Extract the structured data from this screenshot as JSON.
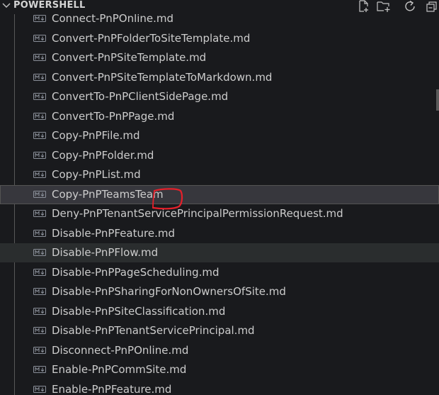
{
  "section": {
    "title": "POWERSHELL",
    "chevron_icon": "chevron-down-icon",
    "actions": [
      {
        "name": "new-file-button",
        "icon": "new-file-icon"
      },
      {
        "name": "new-folder-button",
        "icon": "new-folder-icon"
      },
      {
        "name": "refresh-button",
        "icon": "refresh-icon"
      },
      {
        "name": "collapse-folders-button",
        "icon": "collapse-all-icon"
      }
    ]
  },
  "files": [
    {
      "label": "Connect-PnPOnline.md",
      "icon": "markdown-icon"
    },
    {
      "label": "Convert-PnPFolderToSiteTemplate.md",
      "icon": "markdown-icon"
    },
    {
      "label": "Convert-PnPSiteTemplate.md",
      "icon": "markdown-icon"
    },
    {
      "label": "Convert-PnPSiteTemplateToMarkdown.md",
      "icon": "markdown-icon"
    },
    {
      "label": "ConvertTo-PnPClientSidePage.md",
      "icon": "markdown-icon"
    },
    {
      "label": "ConvertTo-PnPPage.md",
      "icon": "markdown-icon"
    },
    {
      "label": "Copy-PnPFile.md",
      "icon": "markdown-icon"
    },
    {
      "label": "Copy-PnPFolder.md",
      "icon": "markdown-icon"
    },
    {
      "label": "Copy-PnPList.md",
      "icon": "markdown-icon"
    },
    {
      "label": "Copy-PnPTeamsTeam",
      "icon": "markdown-icon",
      "state": "selected"
    },
    {
      "label": "Deny-PnPTenantServicePrincipalPermissionRequest.md",
      "icon": "markdown-icon"
    },
    {
      "label": "Disable-PnPFeature.md",
      "icon": "markdown-icon"
    },
    {
      "label": "Disable-PnPFlow.md",
      "icon": "markdown-icon",
      "state": "hover"
    },
    {
      "label": "Disable-PnPPageScheduling.md",
      "icon": "markdown-icon"
    },
    {
      "label": "Disable-PnPSharingForNonOwnersOfSite.md",
      "icon": "markdown-icon"
    },
    {
      "label": "Disable-PnPSiteClassification.md",
      "icon": "markdown-icon"
    },
    {
      "label": "Disable-PnPTenantServicePrincipal.md",
      "icon": "markdown-icon"
    },
    {
      "label": "Disconnect-PnPOnline.md",
      "icon": "markdown-icon"
    },
    {
      "label": "Enable-PnPCommSite.md",
      "icon": "markdown-icon"
    },
    {
      "label": "Enable-PnPFeature.md",
      "icon": "markdown-icon"
    }
  ],
  "colors": {
    "background": "#191a1d",
    "text": "#cccccc",
    "selected_background": "#37373d",
    "hover_background": "#2a2d2e",
    "annotation": "#e5202a"
  }
}
